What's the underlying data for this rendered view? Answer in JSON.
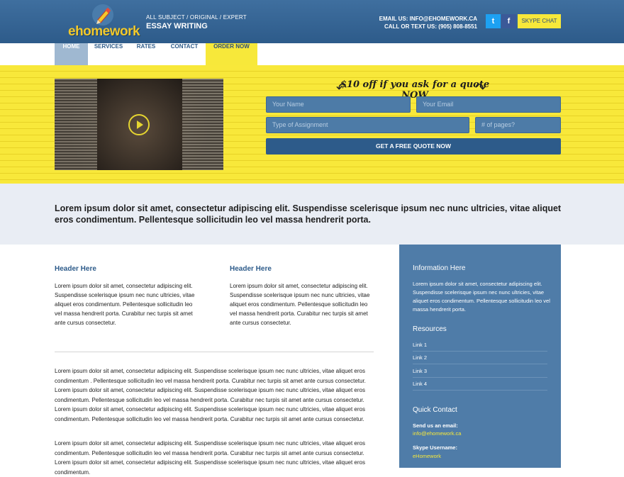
{
  "header": {
    "logo_text": "ehomework",
    "tagline_small": "ALL SUBJECT / ORIGINAL / EXPERT",
    "tagline_big": "ESSAY WRITING",
    "email_line": "EMAIL US: INFO@EHOMEWORK.CA",
    "phone_line": "CALL OR TEXT US: (905) 808-8551",
    "twitter_glyph": "t",
    "facebook_glyph": "f",
    "skype_button": "SKYPE CHAT"
  },
  "nav": {
    "home": "HOME",
    "services": "SERVICES",
    "rates": "RATES",
    "contact": "CONTACT",
    "order": "ORDER NOW"
  },
  "hero": {
    "promo": "$10 off if you ask for a quote NOW",
    "name_placeholder": "Your Name",
    "email_placeholder": "Your Email",
    "type_placeholder": "Type of Assignment",
    "pages_placeholder": "# of pages?",
    "quote_button": "GET A FREE QUOTE NOW"
  },
  "intro": {
    "text": "Lorem ipsum dolor sit amet, consectetur adipiscing elit. Suspendisse scelerisque ipsum nec nunc ultricies, vitae aliquet eros condimentum. Pellentesque sollicitudin leo vel massa hendrerit porta."
  },
  "columns": [
    {
      "header": "Header Here",
      "text": "Lorem ipsum dolor sit amet, consectetur adipiscing elit. Suspendisse scelerisque ipsum nec nunc ultricies, vitae aliquet eros condimentum. Pellentesque sollicitudin leo vel massa hendrerit porta. Curabitur nec turpis sit amet ante cursus consectetur."
    },
    {
      "header": "Header Here",
      "text": "Lorem ipsum dolor sit amet, consectetur adipiscing elit. Suspendisse scelerisque ipsum nec nunc ultricies, vitae aliquet eros condimentum. Pellentesque sollicitudin leo vel massa hendrerit porta. Curabitur nec turpis sit amet ante cursus consectetur."
    }
  ],
  "body": {
    "paragraph1": "Lorem ipsum dolor sit amet, consectetur adipiscing elit. Suspendisse scelerisque ipsum nec nunc ultricies, vitae aliquet eros condimentum . Pellentesque sollicitudin leo vel massa hendrerit porta. Curabitur nec turpis sit amet ante cursus consectetur. Lorem ipsum dolor sit amet, consectetur adipiscing elit. Suspendisse scelerisque ipsum nec nunc ultricies, vitae aliquet eros condimentum. Pellentesque sollicitudin leo vel massa hendrerit porta. Curabitur nec turpis sit amet ante cursus consectetur. Lorem ipsum dolor sit amet, consectetur adipiscing elit. Suspendisse scelerisque ipsum nec nunc ultricies, vitae aliquet eros condimentum. Pellentesque sollicitudin leo vel massa hendrerit porta. Curabitur nec turpis sit amet ante cursus consectetur.",
    "paragraph2": "Lorem ipsum dolor sit amet, consectetur adipiscing elit. Suspendisse scelerisque ipsum nec nunc ultricies, vitae aliquet eros condimentum. Pellentesque sollicitudin leo vel massa hendrerit porta. Curabitur nec turpis sit amet ante cursus consectetur. Lorem ipsum dolor sit amet, consectetur adipiscing elit. Suspendisse scelerisque ipsum nec nunc ultricies, vitae aliquet eros condimentum."
  },
  "sidebar": {
    "info_header": "Information Here",
    "info_text": "Lorem ipsum dolor sit amet, consectetur adipiscing elit. Suspendisse scelerisque ipsum nec nunc ultricies, vitae aliquet eros condimentum. Pellentesque sollicitudin leo vel massa hendrerit porta.",
    "resources_header": "Resources",
    "links": [
      "Link 1",
      "Link 2",
      "Link 3",
      "Link 4"
    ],
    "quick_contact_header": "Quick Contact",
    "email_label": "Send us an email:",
    "email_value": "info@ehomework.ca",
    "skype_label": "Skype Username:",
    "skype_value": "eHomework"
  },
  "colors": {
    "brand_blue": "#2d5b8a",
    "accent_yellow": "#f7e83a",
    "sidebar_blue": "#4f7ca8"
  }
}
